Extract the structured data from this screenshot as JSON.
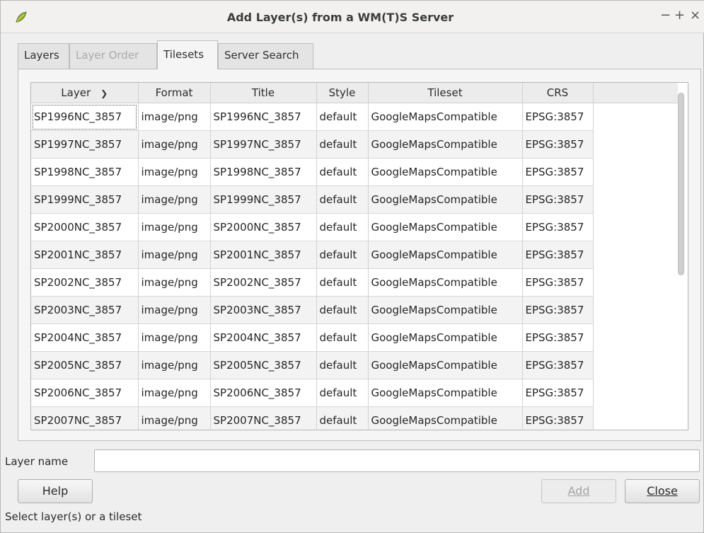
{
  "window": {
    "title": "Add Layer(s) from a WM(T)S Server",
    "controls": {
      "minimize": "−",
      "maximize": "+",
      "close": "×"
    }
  },
  "tabs": [
    {
      "label": "Layers",
      "state": "normal"
    },
    {
      "label": "Layer Order",
      "state": "disabled"
    },
    {
      "label": "Tilesets",
      "state": "active"
    },
    {
      "label": "Server Search",
      "state": "normal"
    }
  ],
  "table": {
    "columns": [
      "Layer",
      "Format",
      "Title",
      "Style",
      "Tileset",
      "CRS"
    ],
    "sort_column": "Layer",
    "rows": [
      [
        "SP1996NC_3857",
        "image/png",
        "SP1996NC_3857",
        "default",
        "GoogleMapsCompatible",
        "EPSG:3857"
      ],
      [
        "SP1997NC_3857",
        "image/png",
        "SP1997NC_3857",
        "default",
        "GoogleMapsCompatible",
        "EPSG:3857"
      ],
      [
        "SP1998NC_3857",
        "image/png",
        "SP1998NC_3857",
        "default",
        "GoogleMapsCompatible",
        "EPSG:3857"
      ],
      [
        "SP1999NC_3857",
        "image/png",
        "SP1999NC_3857",
        "default",
        "GoogleMapsCompatible",
        "EPSG:3857"
      ],
      [
        "SP2000NC_3857",
        "image/png",
        "SP2000NC_3857",
        "default",
        "GoogleMapsCompatible",
        "EPSG:3857"
      ],
      [
        "SP2001NC_3857",
        "image/png",
        "SP2001NC_3857",
        "default",
        "GoogleMapsCompatible",
        "EPSG:3857"
      ],
      [
        "SP2002NC_3857",
        "image/png",
        "SP2002NC_3857",
        "default",
        "GoogleMapsCompatible",
        "EPSG:3857"
      ],
      [
        "SP2003NC_3857",
        "image/png",
        "SP2003NC_3857",
        "default",
        "GoogleMapsCompatible",
        "EPSG:3857"
      ],
      [
        "SP2004NC_3857",
        "image/png",
        "SP2004NC_3857",
        "default",
        "GoogleMapsCompatible",
        "EPSG:3857"
      ],
      [
        "SP2005NC_3857",
        "image/png",
        "SP2005NC_3857",
        "default",
        "GoogleMapsCompatible",
        "EPSG:3857"
      ],
      [
        "SP2006NC_3857",
        "image/png",
        "SP2006NC_3857",
        "default",
        "GoogleMapsCompatible",
        "EPSG:3857"
      ],
      [
        "SP2007NC_3857",
        "image/png",
        "SP2007NC_3857",
        "default",
        "GoogleMapsCompatible",
        "EPSG:3857"
      ]
    ]
  },
  "layer_name": {
    "label": "Layer name",
    "value": ""
  },
  "buttons": {
    "help": "Help",
    "add": "Add",
    "close": "Close"
  },
  "status": "Select layer(s) or a tileset",
  "icons": {
    "app": "qgis-leaf-icon",
    "sort": "chevron-down-icon"
  },
  "colors": {
    "window_bg": "#efefef",
    "row_alt": "#f3f3f3"
  }
}
